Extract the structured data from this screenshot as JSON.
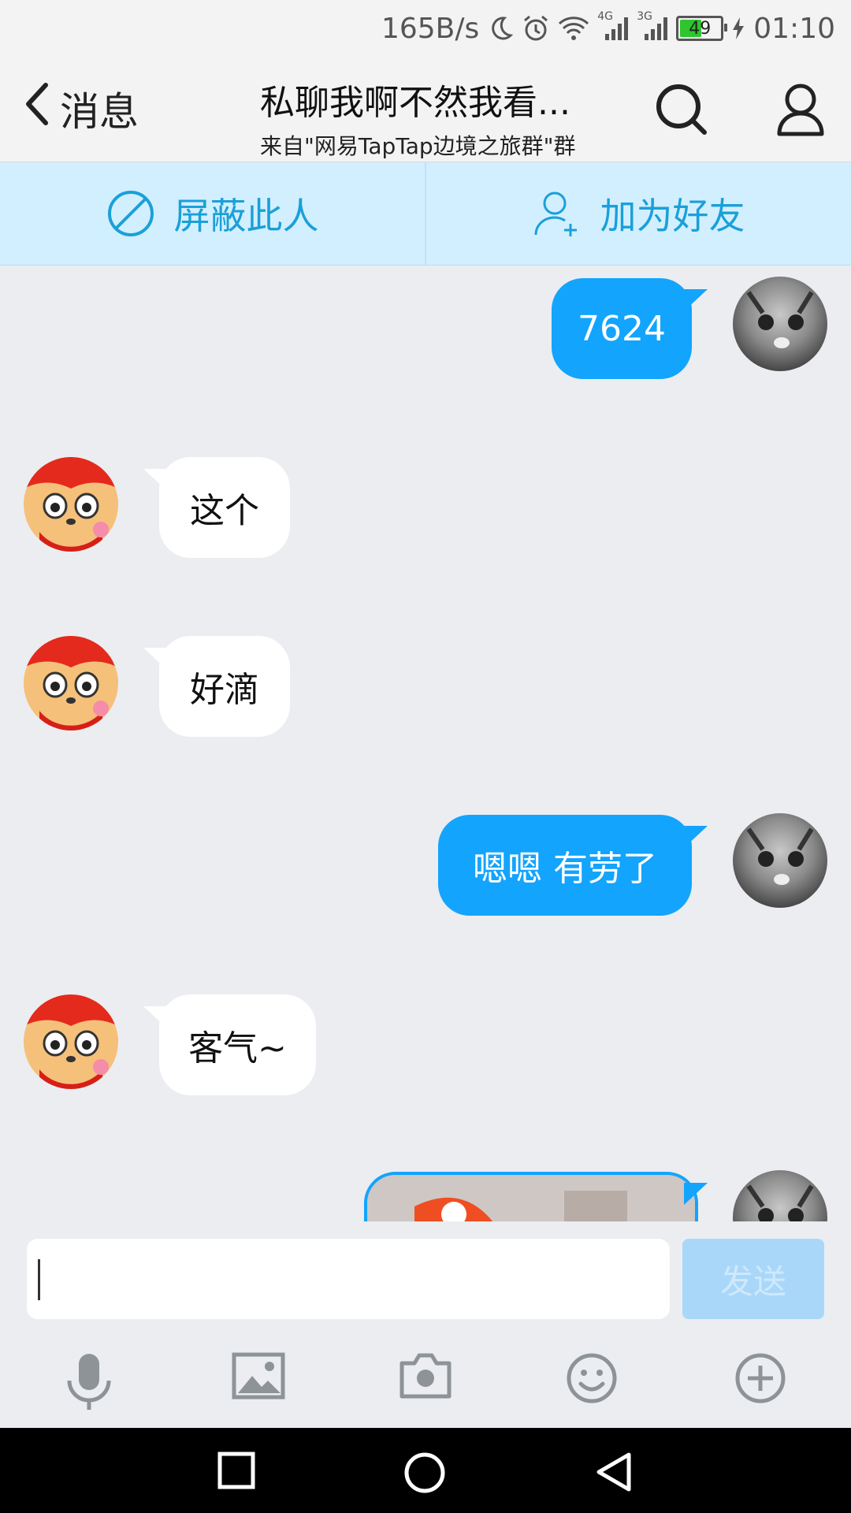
{
  "status_bar": {
    "net_speed": "165B/s",
    "net1": "4G",
    "net2": "3G",
    "battery": "49",
    "time": "01:10"
  },
  "header": {
    "back_label": "消息",
    "title": "私聊我啊不然我看...",
    "subtitle": "来自\"网易TapTap边境之旅群\"群"
  },
  "actions": {
    "block_label": "屏蔽此人",
    "add_friend_label": "加为好友"
  },
  "messages": [
    {
      "side": "out",
      "text": "7624"
    },
    {
      "side": "in",
      "text": "这个"
    },
    {
      "side": "in",
      "text": "好滴"
    },
    {
      "side": "out",
      "text": "嗯嗯 有劳了"
    },
    {
      "side": "in",
      "text": "客气~"
    },
    {
      "side": "out",
      "type": "image",
      "text": ""
    }
  ],
  "input": {
    "value": "",
    "send_label": "发送"
  },
  "icons": {
    "toolbar": [
      "microphone-icon",
      "image-icon",
      "camera-icon",
      "emoji-icon",
      "plus-icon"
    ],
    "nav": [
      "recent-apps-icon",
      "home-icon",
      "back-icon"
    ]
  },
  "colors": {
    "accent": "#13a4fd",
    "strip_bg": "#d2efff",
    "strip_text": "#1aa0d8",
    "send_disabled": "#a9d7f9"
  }
}
